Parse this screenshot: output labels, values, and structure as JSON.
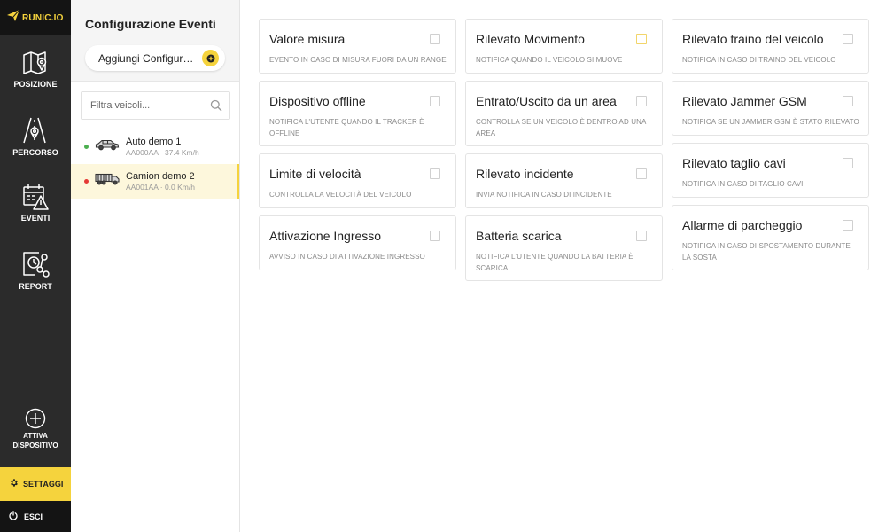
{
  "app": {
    "logo_text": "RUNIC.IO",
    "accent_color": "#f5d33d",
    "dark_color": "#2b2b2b"
  },
  "nav": {
    "items": [
      {
        "label": "POSIZIONE",
        "icon": "map-icon"
      },
      {
        "label": "PERCORSO",
        "icon": "route-icon"
      },
      {
        "label": "EVENTI",
        "icon": "calendar-alert-icon"
      },
      {
        "label": "REPORT",
        "icon": "report-icon"
      }
    ],
    "activate": {
      "label_line1": "ATTIVA",
      "label_line2": "DISPOSITIVO",
      "icon": "plus-circle-icon"
    },
    "settings": {
      "label": "SETTAGGI",
      "icon": "gear-icon"
    },
    "logout": {
      "label": "ESCI",
      "icon": "power-icon"
    }
  },
  "panel": {
    "title": "Configurazione Eventi",
    "add_button_label": "Aggiungi Configurazione",
    "search_placeholder": "Filtra veicoli...",
    "vehicles": [
      {
        "name": "Auto demo 1",
        "sub": "AA000AA · 37.4 Km/h",
        "status_color": "#4caf50",
        "type": "car-icon",
        "selected": false
      },
      {
        "name": "Camion demo 2",
        "sub": "AA001AA · 0.0 Km/h",
        "status_color": "#e53935",
        "type": "truck-icon",
        "selected": true
      }
    ]
  },
  "events": {
    "columns": [
      [
        {
          "title": "Valore misura",
          "desc": "Evento in caso di misura fuori da un range",
          "checked": false
        },
        {
          "title": "Dispositivo offline",
          "desc": "Notifica l'utente quando il tracker è offline",
          "checked": false
        },
        {
          "title": "Limite di velocità",
          "desc": "Controlla la velocità del veicolo",
          "checked": false
        },
        {
          "title": "Attivazione Ingresso",
          "desc": "Avviso in caso di attivazione ingresso",
          "checked": false
        }
      ],
      [
        {
          "title": "Rilevato Movimento",
          "desc": "Notifica quando il veicolo si muove",
          "checked": false,
          "highlight": true
        },
        {
          "title": "Entrato/Uscito da un area",
          "desc": "Controlla se un veicolo è dentro ad una area",
          "checked": false
        },
        {
          "title": "Rilevato incidente",
          "desc": "Invia notifica in caso di incidente",
          "checked": false
        },
        {
          "title": "Batteria scarica",
          "desc": "Notifica l'utente quando la batteria è scarica",
          "checked": false
        }
      ],
      [
        {
          "title": "Rilevato traino del veicolo",
          "desc": "Notifica in caso di traino del veicolo",
          "checked": false
        },
        {
          "title": "Rilevato Jammer GSM",
          "desc": "Notifica se un jammer GSM è stato rilevato",
          "checked": false
        },
        {
          "title": "Rilevato taglio cavi",
          "desc": "Notifica in caso di taglio cavi",
          "checked": false
        },
        {
          "title": "Allarme di parcheggio",
          "desc": "Notifica in caso di spostamento durante la sosta",
          "checked": false
        }
      ]
    ]
  }
}
